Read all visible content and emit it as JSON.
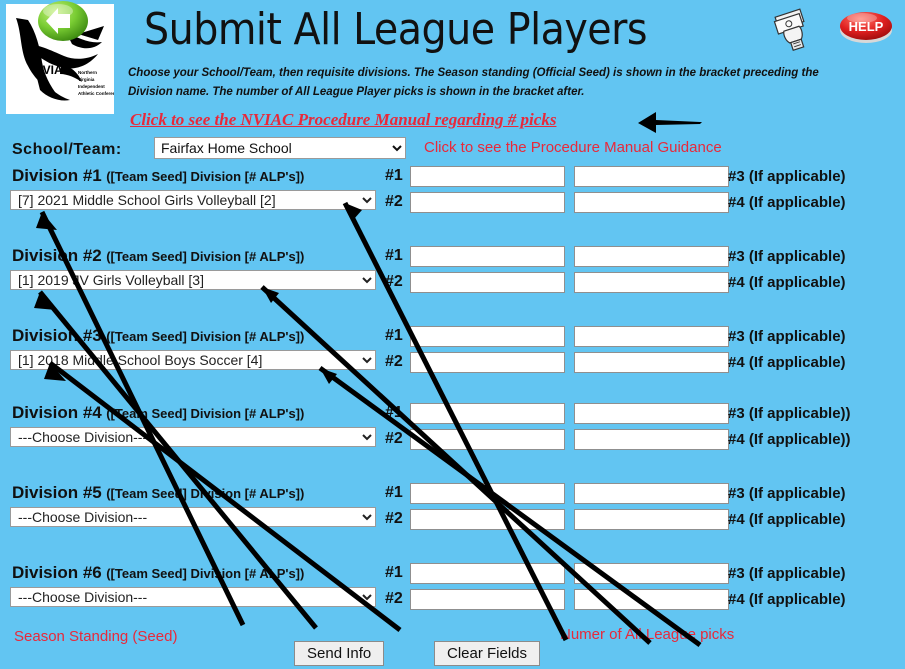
{
  "header": {
    "title": "Submit All League Players",
    "logo_text": "NVIAC",
    "logo_sub": "Northern Virginia Independent Athletic Conference",
    "back_arrow_icon": "green-back-arrow-icon",
    "money_icon": "hand-holding-money-icon",
    "help_label": "HELP",
    "instructions_line1": "Choose your School/Team, then requisite divisions. The Season standing (Official Seed) is shown in the bracket preceding the",
    "instructions_line2": "Division name. The number of All League Player picks is shown in the bracket after.",
    "manual_link": "Click to see the NVIAC Procedure Manual regarding # picks"
  },
  "school_row": {
    "label": "School/Team:",
    "selected": "Fairfax Home School",
    "guidance": "Click to see the Procedure Manual Guidance"
  },
  "divisions": [
    {
      "title": "Division #1",
      "subtitle": "([Team Seed] Division [# ALP's])",
      "selected": "[7] 2021 Middle School Girls Volleyball [2]",
      "picks": [
        {
          "tag": "#1",
          "value": "",
          "right_label": "#3 (If applicable)"
        },
        {
          "tag": "#2",
          "value": "",
          "right_label": "#4 (If applicable)"
        }
      ]
    },
    {
      "title": "Division #2",
      "subtitle": "([Team Seed] Division [# ALP's])",
      "selected": "[1] 2019 JV Girls Volleyball [3]",
      "picks": [
        {
          "tag": "#1",
          "value": "",
          "right_label": "#3 (If applicable)"
        },
        {
          "tag": "#2",
          "value": "",
          "right_label": "#4 (If applicable)"
        }
      ]
    },
    {
      "title": "Division #3",
      "subtitle": "([Team Seed] Division [# ALP's])",
      "selected": "[1] 2018 Middle School Boys Soccer [4]",
      "picks": [
        {
          "tag": "#1",
          "value": "",
          "right_label": "#3 (If applicable)"
        },
        {
          "tag": "#2",
          "value": "",
          "right_label": "#4 (If applicable)"
        }
      ]
    },
    {
      "title": "Division #4",
      "subtitle": "([Team Seed] Division [# ALP's])",
      "selected": "---Choose Division---",
      "picks": [
        {
          "tag": "#1",
          "value": "",
          "right_label": "#3 (If applicable))"
        },
        {
          "tag": "#2",
          "value": "",
          "right_label": "#4 (If applicable))"
        }
      ]
    },
    {
      "title": "Division #5",
      "subtitle": "([Team Seed] Division [# ALP's])",
      "selected": "---Choose Division---",
      "picks": [
        {
          "tag": "#1",
          "value": "",
          "right_label": "#3 (If applicable)"
        },
        {
          "tag": "#2",
          "value": "",
          "right_label": "#4 (If applicable)"
        }
      ]
    },
    {
      "title": "Division #6",
      "subtitle": "([Team Seed] Division [# ALP's])",
      "selected": "---Choose Division---",
      "picks": [
        {
          "tag": "#1",
          "value": "",
          "right_label": "#3 (If applicable)"
        },
        {
          "tag": "#2",
          "value": "",
          "right_label": "#4 (If applicable)"
        }
      ]
    }
  ],
  "footer": {
    "note_left": "Season Standing (Seed)",
    "note_right": "Numer of All League picks",
    "send_label": "Send Info",
    "clear_label": "Clear Fields"
  },
  "colors": {
    "background": "#62C5F2",
    "annotation_red": "#E8293A",
    "text": "#111111",
    "help_red": "#E02020",
    "back_green": "#57B832"
  }
}
